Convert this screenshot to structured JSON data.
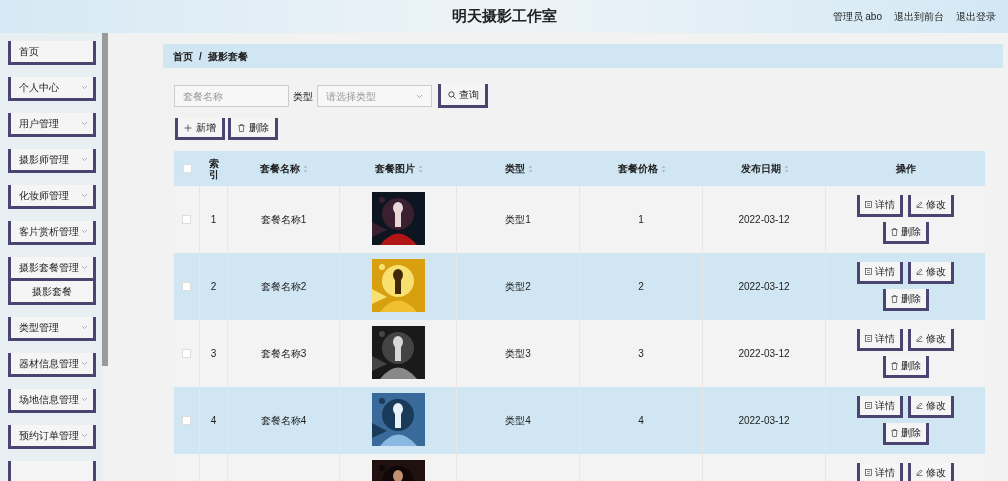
{
  "header": {
    "title": "明天摄影工作室",
    "links": [
      "管理员 abo",
      "退出到前台",
      "退出登录"
    ]
  },
  "sidebar": {
    "items": [
      {
        "label": "首页",
        "has_children": false
      },
      {
        "label": "个人中心",
        "has_children": true
      },
      {
        "label": "用户管理",
        "has_children": true
      },
      {
        "label": "摄影师管理",
        "has_children": true
      },
      {
        "label": "化妆师管理",
        "has_children": true
      },
      {
        "label": "客片赏析管理",
        "has_children": true
      },
      {
        "label": "摄影套餐管理",
        "has_children": true,
        "children": [
          {
            "label": "摄影套餐"
          }
        ]
      },
      {
        "label": "类型管理",
        "has_children": true
      },
      {
        "label": "器材信息管理",
        "has_children": true
      },
      {
        "label": "场地信息管理",
        "has_children": true
      },
      {
        "label": "预约订单管理",
        "has_children": true
      }
    ]
  },
  "breadcrumb": {
    "items": [
      "首页",
      "摄影套餐"
    ],
    "separator": "/"
  },
  "search": {
    "name_placeholder": "套餐名称",
    "type_label": "类型",
    "type_placeholder": "请选择类型",
    "button": "查询"
  },
  "toolbar": [
    {
      "kind": "add",
      "label": "新增"
    },
    {
      "kind": "delete",
      "label": "删除"
    }
  ],
  "table": {
    "select_all_checked": false,
    "columns": [
      {
        "kind": "checkbox",
        "sortable": false
      },
      {
        "label": "索引",
        "kind": "index",
        "sortable": false
      },
      {
        "label": "套餐名称",
        "kind": "text",
        "sortable": true
      },
      {
        "label": "套餐图片",
        "kind": "picture",
        "sortable": true
      },
      {
        "label": "类型",
        "kind": "text",
        "sortable": true
      },
      {
        "label": "套餐价格",
        "kind": "text",
        "sortable": true
      },
      {
        "label": "发布日期",
        "kind": "text",
        "sortable": true
      },
      {
        "label": "操作",
        "kind": "actions",
        "sortable": false
      }
    ],
    "rows": [
      {
        "checked": false,
        "index": "1",
        "name": "套餐名称1",
        "type": "类型1",
        "price": "1",
        "date": "2022-03-12",
        "actions": [
          {
            "kind": "detail",
            "label": "详情"
          },
          {
            "kind": "edit",
            "label": "修改"
          },
          {
            "kind": "delete",
            "label": "删除"
          }
        ]
      },
      {
        "checked": false,
        "index": "2",
        "name": "套餐名称2",
        "type": "类型2",
        "price": "2",
        "date": "2022-03-12",
        "actions": [
          {
            "kind": "detail",
            "label": "详情"
          },
          {
            "kind": "edit",
            "label": "修改"
          },
          {
            "kind": "delete",
            "label": "删除"
          }
        ]
      },
      {
        "checked": false,
        "index": "3",
        "name": "套餐名称3",
        "type": "类型3",
        "price": "3",
        "date": "2022-03-12",
        "actions": [
          {
            "kind": "detail",
            "label": "详情"
          },
          {
            "kind": "edit",
            "label": "修改"
          },
          {
            "kind": "delete",
            "label": "删除"
          }
        ]
      },
      {
        "checked": false,
        "index": "4",
        "name": "套餐名称4",
        "type": "类型4",
        "price": "4",
        "date": "2022-03-12",
        "actions": [
          {
            "kind": "detail",
            "label": "详情"
          },
          {
            "kind": "edit",
            "label": "修改"
          },
          {
            "kind": "delete",
            "label": "删除"
          }
        ]
      },
      {
        "actions": [
          {
            "kind": "detail",
            "label": "详情"
          },
          {
            "kind": "edit",
            "label": "修改"
          }
        ]
      }
    ]
  }
}
